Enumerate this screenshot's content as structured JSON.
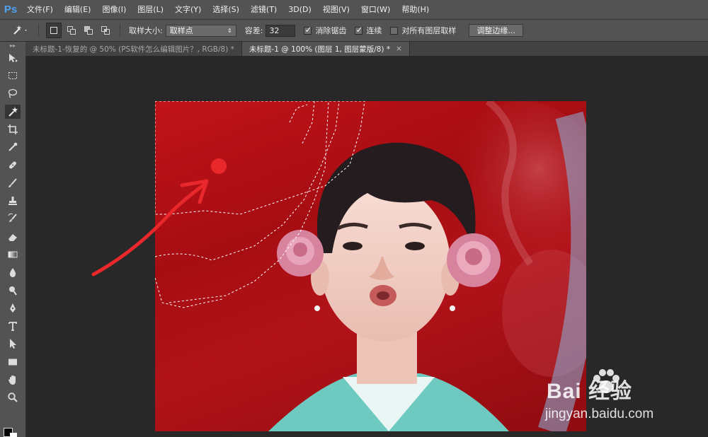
{
  "app": {
    "logo": "Ps"
  },
  "menu": [
    "文件(F)",
    "编辑(E)",
    "图像(I)",
    "图层(L)",
    "文字(Y)",
    "选择(S)",
    "滤镜(T)",
    "3D(D)",
    "视图(V)",
    "窗口(W)",
    "帮助(H)"
  ],
  "options": {
    "tool_icon": "magic-wand-icon",
    "sample_size_label": "取样大小:",
    "sample_size_value": "取样点",
    "tolerance_label": "容差:",
    "tolerance_value": "32",
    "antialias_label": "消除锯齿",
    "antialias_checked": true,
    "contiguous_label": "连续",
    "contiguous_checked": true,
    "sample_all_layers_label": "对所有图层取样",
    "sample_all_layers_checked": false,
    "refine_edge_label": "调整边缘..."
  },
  "tabs": [
    {
      "label": "未标题-1-恢复的 @ 50% (PS软件怎么编辑图片？, RGB/8) *",
      "active": false
    },
    {
      "label": "未标题-1 @ 100% (图层 1, 图层蒙版/8) *",
      "active": true
    }
  ],
  "tools": [
    "move-tool-icon",
    "marquee-tool-icon",
    "lasso-tool-icon",
    "magic-wand-tool-icon",
    "crop-tool-icon",
    "eyedropper-tool-icon",
    "healing-brush-icon",
    "brush-tool-icon",
    "clone-stamp-icon",
    "history-brush-icon",
    "eraser-tool-icon",
    "gradient-tool-icon",
    "blur-tool-icon",
    "dodge-tool-icon",
    "pen-tool-icon",
    "type-tool-icon",
    "path-selection-icon",
    "rectangle-tool-icon",
    "hand-tool-icon",
    "zoom-tool-icon"
  ],
  "selected_tool_index": 3,
  "watermark": {
    "brand": "Bai 经验",
    "url": "jingyan.baidu.com"
  },
  "colors": {
    "foreground": "#000000",
    "background": "#ffffff",
    "accent": "#4fa3f0",
    "annotation": "#e8282b"
  }
}
